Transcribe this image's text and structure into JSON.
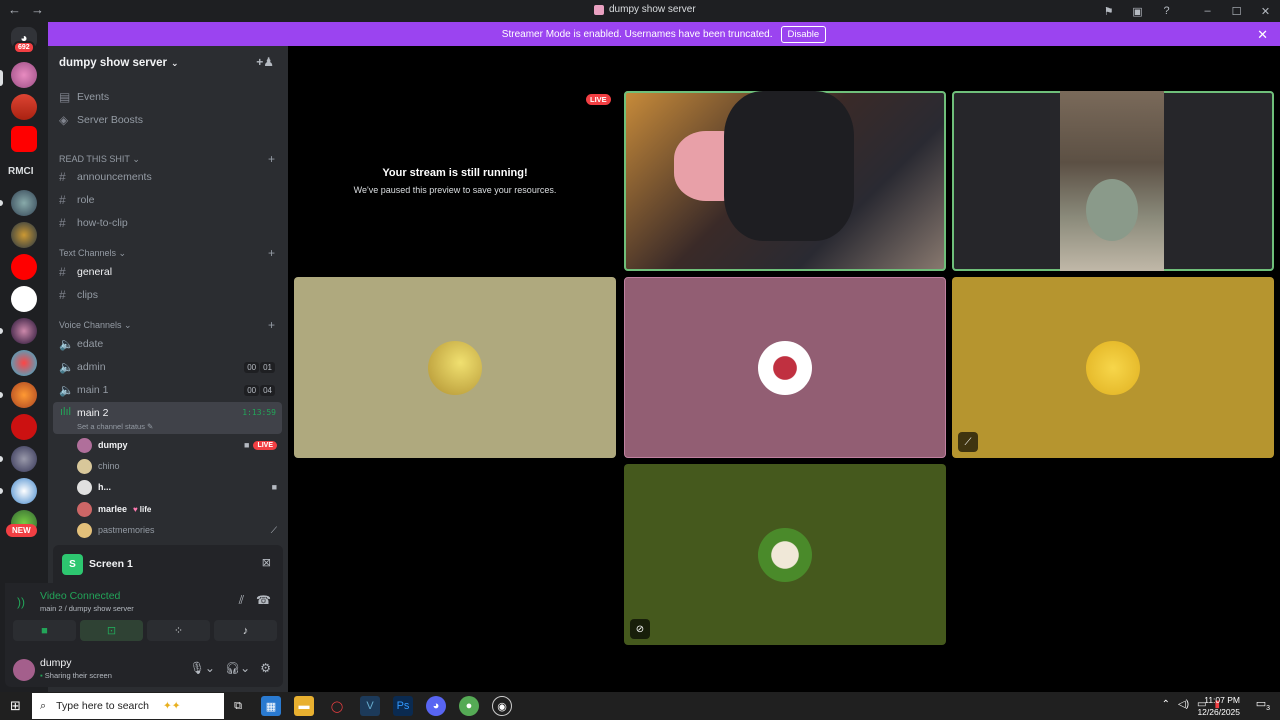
{
  "window": {
    "title": "dumpy show server"
  },
  "banner": {
    "text": "Streamer Mode is enabled. Usernames have been truncated.",
    "disable_label": "Disable"
  },
  "guilds": {
    "mention_count": "692",
    "rmci_label": "RMCI",
    "new_label": "NEW"
  },
  "server": {
    "name": "dumpy show server"
  },
  "sidebar": {
    "events": "Events",
    "boosts": "Server Boosts",
    "cat_read": "READ THIS SHIT",
    "announcements": "announcements",
    "role": "role",
    "how_to_clip": "how-to-clip",
    "cat_text": "Text Channels",
    "general": "general",
    "clips": "clips",
    "cat_voice": "Voice Channels",
    "edate": "edate",
    "admin": "admin",
    "admin_counts": [
      "00",
      "01"
    ],
    "main1": "main 1",
    "main1_counts": [
      "00",
      "04"
    ],
    "main2": "main 2",
    "main2_timer": "1:13:59",
    "main2_status": "Set a channel status",
    "members": [
      {
        "name": "dumpy",
        "badge": "LIVE"
      },
      {
        "name": "chino"
      },
      {
        "name": "h..."
      },
      {
        "name": "marlee",
        "tag": "life"
      },
      {
        "name": "pastmemories"
      }
    ]
  },
  "screen_panel": {
    "label": "Screen 1"
  },
  "voice_panel": {
    "status": "Video Connected",
    "location": "main 2 / dumpy show server"
  },
  "user_panel": {
    "name": "dumpy",
    "status": "Sharing their screen"
  },
  "stage": {
    "paused_title": "Your stream is still running!",
    "paused_sub": "We've paused this preview to save your resources.",
    "live_label": "LIVE"
  },
  "taskbar": {
    "search_placeholder": "Type here to search",
    "time": "11:07 PM",
    "date": "12/26/2025",
    "notif_count": "3"
  },
  "colors": {
    "accent_purple": "#9b44f0",
    "live_red": "#f23f43",
    "connected_green": "#23a559"
  }
}
